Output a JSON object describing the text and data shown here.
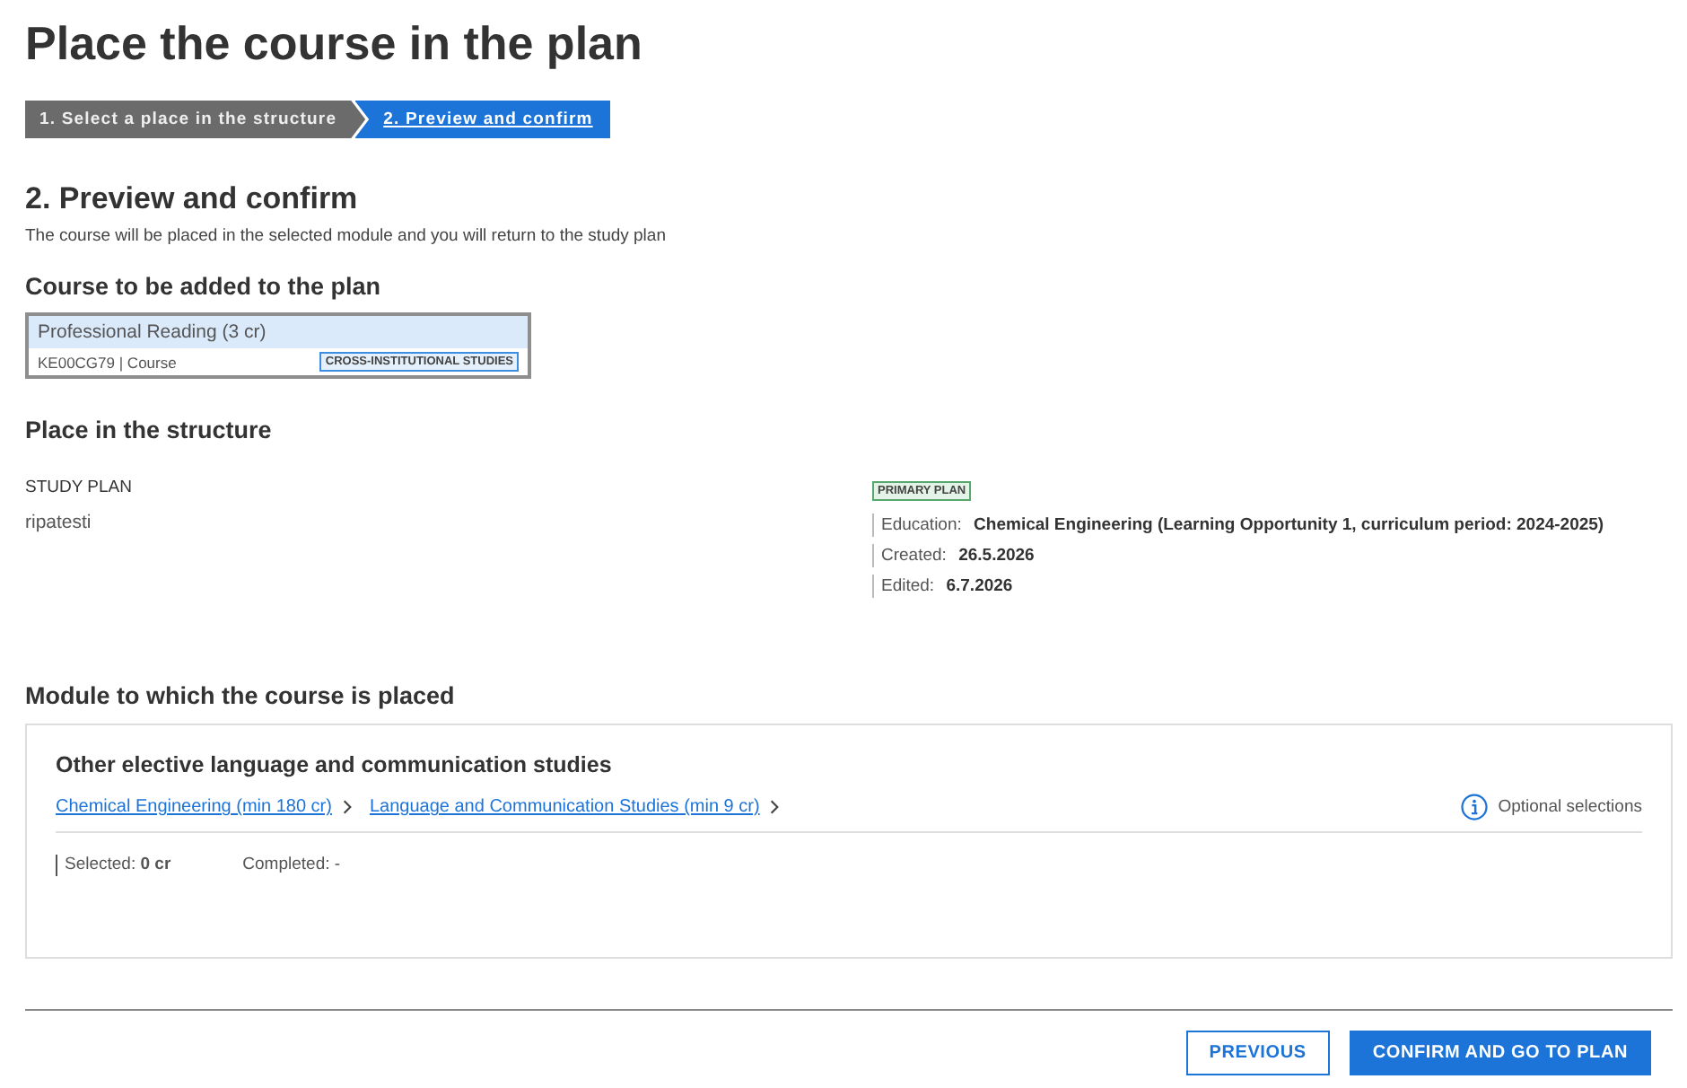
{
  "page": {
    "title": "Place the course in the plan"
  },
  "steps": [
    {
      "label": "1. Select a place in the structure",
      "selected": false
    },
    {
      "label": "2. Preview and confirm",
      "selected": true
    }
  ],
  "section": {
    "heading": "2. Preview and confirm",
    "description": "The course will be placed in the selected module and you will return to the study plan"
  },
  "course_section": {
    "heading": "Course to be added to the plan",
    "course": {
      "name": "Professional Reading (3 cr)",
      "code_type": "KE00CG79 | Course",
      "tag": "CROSS-INSTITUTIONAL STUDIES"
    }
  },
  "structure": {
    "heading": "Place in the structure",
    "plan_label": "STUDY PLAN",
    "plan_name": "ripatesti",
    "badge": "PRIMARY PLAN",
    "details": [
      {
        "label": "Education:",
        "value": "Chemical Engineering (Learning Opportunity 1, curriculum period: 2024-2025)"
      },
      {
        "label": "Created:",
        "value": "26.5.2026"
      },
      {
        "label": "Edited:",
        "value": "6.7.2026"
      }
    ]
  },
  "module_section": {
    "heading": "Module to which the course is placed",
    "module": {
      "title": "Other elective language and communication studies",
      "breadcrumbs": [
        "Chemical Engineering (min 180 cr)",
        "Language and Communication Studies (min 9 cr)"
      ],
      "info": "Optional selections",
      "selected": "Selected: **0 cr**",
      "completed": "Completed: -"
    }
  },
  "buttons": [
    {
      "label": "PREVIOUS",
      "kind": "secondary"
    },
    {
      "label": "CONFIRM AND GO TO PLAN",
      "kind": "primary"
    }
  ]
}
